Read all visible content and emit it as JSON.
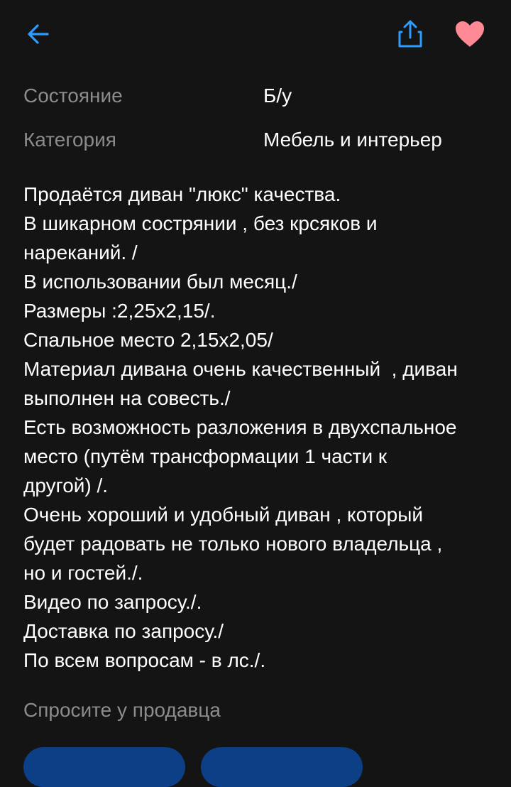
{
  "colors": {
    "background": "#141414",
    "accent": "#2d9cff",
    "favorite": "#ff8a95",
    "secondary_text": "#8c8c8c",
    "button": "#0d3f86"
  },
  "icons": {
    "back": "arrow-left-icon",
    "share": "share-icon",
    "favorite": "heart-icon"
  },
  "params": [
    {
      "name": "Состояние",
      "value": "Б/у"
    },
    {
      "name": "Категория",
      "value": "Мебель и интерьер"
    }
  ],
  "description": [
    "Продаётся диван \"люкс\" качества.",
    "В шикарном сострянии , без крсяков и",
    "нареканий. /",
    "В использовании был месяц./",
    "Размеры :2,25х2,15/.",
    "Спальное место 2,15х2,05/",
    "Материал дивана очень качественный  , диван",
    "выполнен на совесть./",
    "Есть возможность разложения в двухспальное",
    "место (путём трансформации 1 части к",
    "другой) /.",
    "Очень хороший и удобный диван , который",
    "будет радовать не только нового владельца ,",
    "но и гостей./.",
    "Видео по запросу./.",
    "Доставка по запросу./",
    "По всем вопросам - в лс./."
  ],
  "ask_seller": {
    "title": "Спросите у продавца"
  }
}
